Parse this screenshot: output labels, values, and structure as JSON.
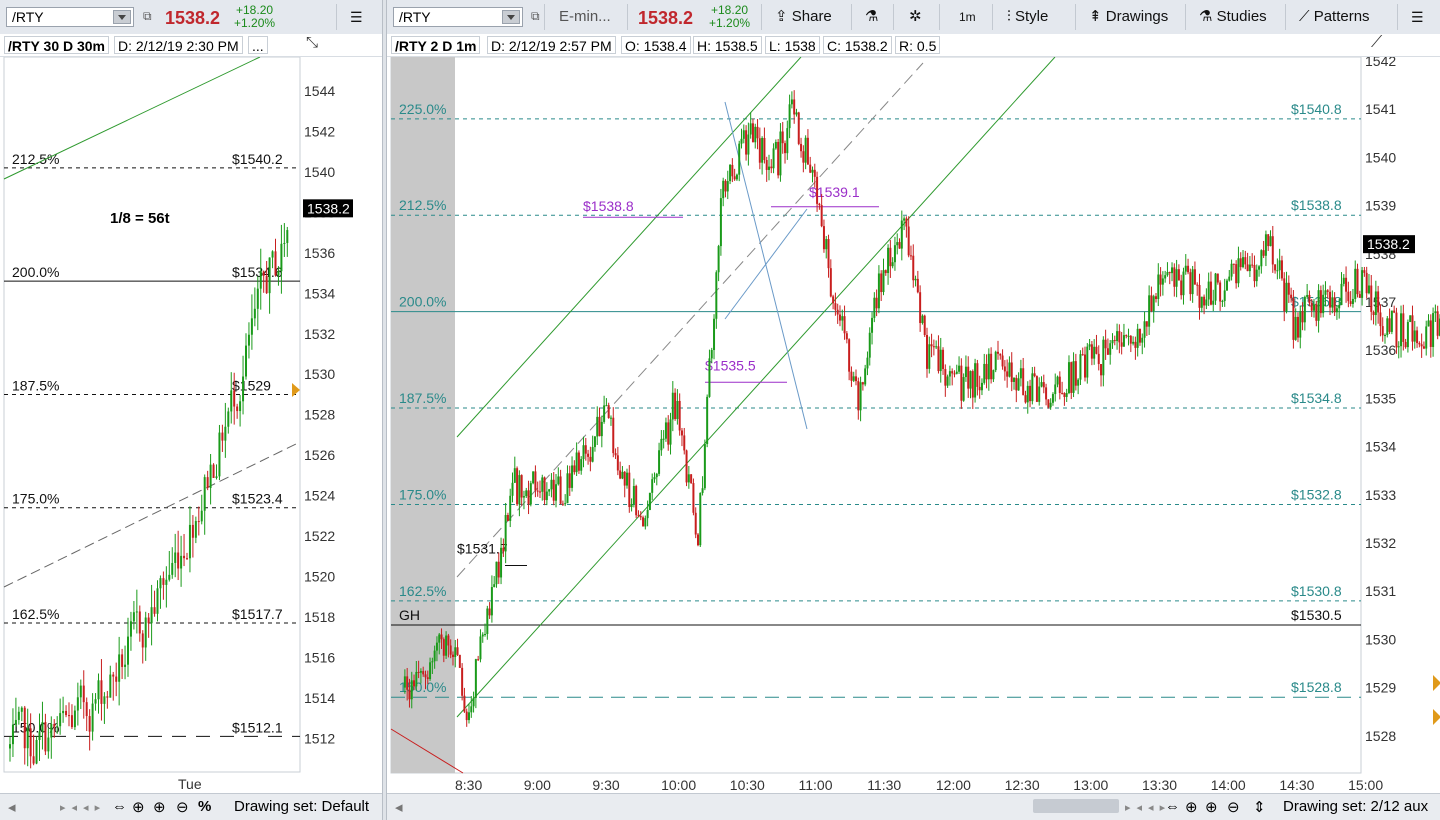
{
  "left": {
    "symbol": "/RTY",
    "price": "1538.2",
    "change": "+18.20",
    "change_pct": "+1.20%",
    "chart_title": "/RTY 30 D 30m",
    "chart_date": "D: 2/12/19 2:30 PM",
    "more": "...",
    "annotation": "1/8 = 56t",
    "last_price_tag": "1538.2",
    "x_label": "Tue",
    "drawing_set": "Drawing set: Default",
    "percent_icon": "%",
    "y_ticks": [
      "1544",
      "1542",
      "1540",
      "1538",
      "1536",
      "1534",
      "1532",
      "1530",
      "1528",
      "1526",
      "1524",
      "1522",
      "1520",
      "1518",
      "1516",
      "1514",
      "1512"
    ],
    "levels": [
      {
        "pct": "212.5%",
        "price": "$1540.2"
      },
      {
        "pct": "200.0%",
        "price": "$1534.6"
      },
      {
        "pct": "187.5%",
        "price": "$1529"
      },
      {
        "pct": "175.0%",
        "price": "$1523.4"
      },
      {
        "pct": "162.5%",
        "price": "$1517.7"
      },
      {
        "pct": "150.0%",
        "price": "$1512.1"
      }
    ]
  },
  "right": {
    "symbol": "/RTY",
    "name": "E-min...",
    "price": "1538.2",
    "change": "+18.20",
    "change_pct": "+1.20%",
    "toolbar": {
      "share": "Share",
      "interval": "1m",
      "style": "Style",
      "drawings": "Drawings",
      "studies": "Studies",
      "patterns": "Patterns"
    },
    "chart_title": "/RTY 2 D 1m",
    "chart_date": "D: 2/12/19 2:57 PM",
    "open": "O: 1538.4",
    "high": "H: 1538.5",
    "low": "L: 1538",
    "close": "C: 1538.2",
    "range": "R: 0.5",
    "last_price_tag": "1538.2",
    "gh_label": "GH",
    "gh_price": "$1530.5",
    "drawing_set": "Drawing set: 2/12 aux",
    "x_ticks": [
      "8:30",
      "9:00",
      "9:30",
      "10:00",
      "10:30",
      "11:00",
      "11:30",
      "12:00",
      "12:30",
      "13:00",
      "13:30",
      "14:00",
      "14:30",
      "15:00"
    ],
    "y_ticks": [
      "1542",
      "1541",
      "1540",
      "1539",
      "1538",
      "1537",
      "1536",
      "1535",
      "1534",
      "1533",
      "1532",
      "1531",
      "1530",
      "1529",
      "1528"
    ],
    "levels": [
      {
        "pct": "225.0%",
        "price": "$1540.8"
      },
      {
        "pct": "212.5%",
        "price": "$1538.8"
      },
      {
        "pct": "200.0%",
        "price": "$1536.8"
      },
      {
        "pct": "187.5%",
        "price": "$1534.8"
      },
      {
        "pct": "175.0%",
        "price": "$1532.8"
      },
      {
        "pct": "162.5%",
        "price": "$1530.8"
      },
      {
        "pct": "150.0%",
        "price": "$1528.8"
      }
    ],
    "callouts": [
      "$1538.8",
      "$1539.1",
      "$1535.5",
      "$1531.7"
    ]
  },
  "colors": {
    "up": "#1a9a1a",
    "down": "#c81e1e",
    "fib": "#2a8a8a",
    "callout": "#9b2fc9",
    "channel": "#2f9a2f",
    "price_red": "#c0272d"
  }
}
